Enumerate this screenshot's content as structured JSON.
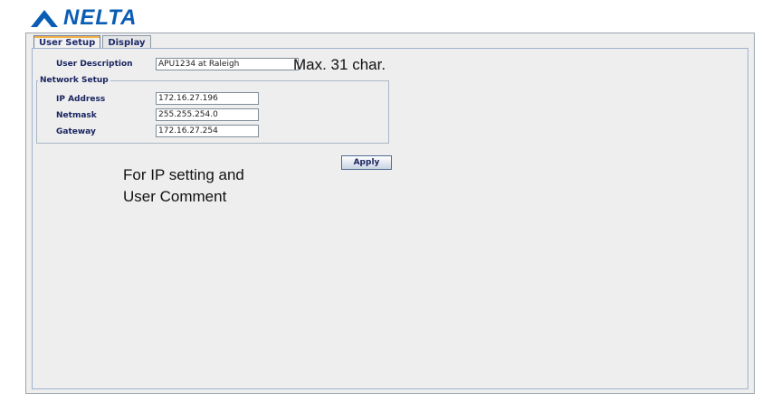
{
  "brand": {
    "name": "NELTA",
    "color": "#0a5db5"
  },
  "tabs": [
    {
      "label": "User Setup",
      "active": true
    },
    {
      "label": "Display",
      "active": false
    }
  ],
  "user_setup": {
    "description_label": "User Description",
    "description_value": "APU1234 at Raleigh",
    "max_chars_note": "Max. 31 char.",
    "network_group_title": "Network Setup",
    "ip_label": "IP Address",
    "ip_value": "172.16.27.196",
    "netmask_label": "Netmask",
    "netmask_value": "255.255.254.0",
    "gateway_label": "Gateway",
    "gateway_value": "172.16.27.254",
    "apply_label": "Apply"
  },
  "annotation": {
    "line1": "For IP setting and",
    "line2": "User Comment"
  }
}
